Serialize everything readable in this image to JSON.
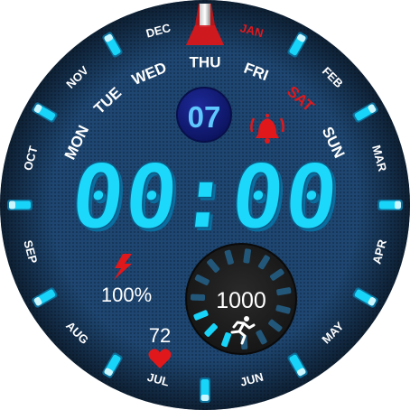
{
  "months": [
    {
      "label": "JAN",
      "angle": 15,
      "highlight": true
    },
    {
      "label": "FEB",
      "angle": 45,
      "highlight": false
    },
    {
      "label": "MAR",
      "angle": 75,
      "highlight": false
    },
    {
      "label": "APR",
      "angle": 105,
      "highlight": false
    },
    {
      "label": "MAY",
      "angle": 135,
      "highlight": false
    },
    {
      "label": "JUN",
      "angle": 165,
      "highlight": false
    },
    {
      "label": "JUL",
      "angle": 195,
      "highlight": false
    },
    {
      "label": "AUG",
      "angle": 225,
      "highlight": false
    },
    {
      "label": "SEP",
      "angle": 255,
      "highlight": false
    },
    {
      "label": "OCT",
      "angle": 285,
      "highlight": false
    },
    {
      "label": "NOV",
      "angle": 315,
      "highlight": false
    },
    {
      "label": "DEC",
      "angle": 345,
      "highlight": false
    }
  ],
  "weekdays": [
    {
      "label": "MON",
      "angle": -64,
      "highlight": false
    },
    {
      "label": "TUE",
      "angle": -43,
      "highlight": false
    },
    {
      "label": "WED",
      "angle": -23,
      "highlight": false
    },
    {
      "label": "THU",
      "angle": 0,
      "highlight": false
    },
    {
      "label": "FRI",
      "angle": 21,
      "highlight": false
    },
    {
      "label": "SAT",
      "angle": 42,
      "highlight": true
    },
    {
      "label": "SUN",
      "angle": 64,
      "highlight": false
    }
  ],
  "date": "07",
  "time": "00:00",
  "battery": {
    "value": "100%",
    "icon": "lightning-icon"
  },
  "heart_rate": {
    "value": "72",
    "icon": "heart-icon"
  },
  "steps": {
    "value": "1000",
    "icon": "running-person-icon",
    "progress": 0.2
  },
  "alarm_icon": "alarm-bell-icon",
  "colors": {
    "background": "#1c3f66",
    "accent": "#18d4f8",
    "digit_glow": "#0e8cc2",
    "highlight_red": "#e0181c",
    "label": "#ffffff"
  }
}
